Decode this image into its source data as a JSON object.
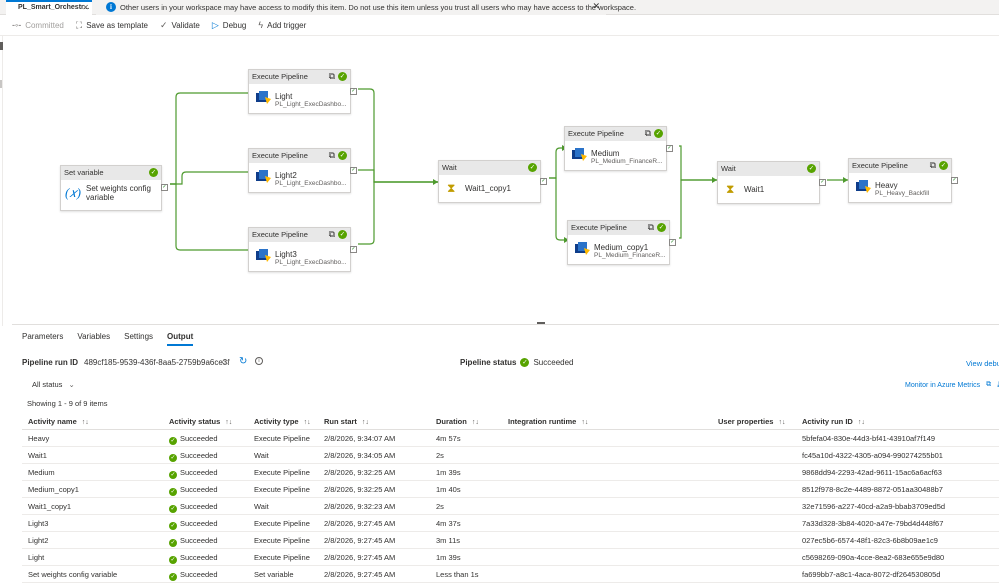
{
  "tab": {
    "title": "PL_Smart_Orchestr...",
    "close": "✕"
  },
  "banner": {
    "icon": "i",
    "text": "Other users in your workspace may have access to modify this item. Do not use this item unless you trust all users who may have access to the workspace.",
    "close": "✕"
  },
  "toolbar": {
    "committed": "Committed",
    "save_as_template": "Save as template",
    "validate": "Validate",
    "debug": "Debug",
    "add_trigger": "Add trigger"
  },
  "colors": {
    "accent": "#0078d4",
    "success": "#57a300",
    "edge": "#4e9a2e"
  },
  "nodes": {
    "set_variable": {
      "header": "Set variable",
      "title": "Set weights config variable",
      "icon": "x"
    },
    "light": {
      "header": "Execute Pipeline",
      "title": "Light",
      "sub": "PL_Light_ExecDashbo..."
    },
    "light2": {
      "header": "Execute Pipeline",
      "title": "Light2",
      "sub": "PL_Light_ExecDashbo..."
    },
    "light3": {
      "header": "Execute Pipeline",
      "title": "Light3",
      "sub": "PL_Light_ExecDashbo..."
    },
    "wait1_copy1": {
      "header": "Wait",
      "title": "Wait1_copy1"
    },
    "medium": {
      "header": "Execute Pipeline",
      "title": "Medium",
      "sub": "PL_Medium_FinanceR..."
    },
    "medium_copy1": {
      "header": "Execute Pipeline",
      "title": "Medium_copy1",
      "sub": "PL_Medium_FinanceR..."
    },
    "wait1": {
      "header": "Wait",
      "title": "Wait1"
    },
    "heavy": {
      "header": "Execute Pipeline",
      "title": "Heavy",
      "sub": "PL_Heavy_Backfill"
    }
  },
  "panel_tabs": [
    "Parameters",
    "Variables",
    "Settings",
    "Output"
  ],
  "run": {
    "label": "Pipeline run ID",
    "id": "489cf185-9539-436f-8aa5-2759b9a6ce3f",
    "status_label": "Pipeline status",
    "status": "Succeeded",
    "view_debug": "View debu"
  },
  "filter": {
    "label": "All status",
    "chevron": "⌄"
  },
  "monitor_link": "Monitor in Azure Metrics",
  "showing": "Showing 1 - 9 of 9 items",
  "table": {
    "columns": [
      "Activity name",
      "Activity status",
      "Activity type",
      "Run start",
      "Duration",
      "Integration runtime",
      "User properties",
      "Activity run ID"
    ],
    "rows": [
      [
        "Heavy",
        "Succeeded",
        "Execute Pipeline",
        "2/8/2026, 9:34:07 AM",
        "4m 57s",
        "",
        "",
        "5bfefa04-830e-44d3-bf41-43910af7f149"
      ],
      [
        "Wait1",
        "Succeeded",
        "Wait",
        "2/8/2026, 9:34:05 AM",
        "2s",
        "",
        "",
        "fc45a10d-4322-4305-a094-990274255b01"
      ],
      [
        "Medium",
        "Succeeded",
        "Execute Pipeline",
        "2/8/2026, 9:32:25 AM",
        "1m 39s",
        "",
        "",
        "9868dd94-2293-42ad-9611-15ac6a6acf63"
      ],
      [
        "Medium_copy1",
        "Succeeded",
        "Execute Pipeline",
        "2/8/2026, 9:32:25 AM",
        "1m 40s",
        "",
        "",
        "8512f978-8c2e-4489-8872-051aa30488b7"
      ],
      [
        "Wait1_copy1",
        "Succeeded",
        "Wait",
        "2/8/2026, 9:32:23 AM",
        "2s",
        "",
        "",
        "32e71596-a227-40cd-a2a9-bbab3709ed5d"
      ],
      [
        "Light3",
        "Succeeded",
        "Execute Pipeline",
        "2/8/2026, 9:27:45 AM",
        "4m 37s",
        "",
        "",
        "7a33d328-3b84-4020-a47e-79bd4d448f67"
      ],
      [
        "Light2",
        "Succeeded",
        "Execute Pipeline",
        "2/8/2026, 9:27:45 AM",
        "3m 11s",
        "",
        "",
        "027ec5b6-6574-48f1-82c3-6b8b09ae1c9"
      ],
      [
        "Light",
        "Succeeded",
        "Execute Pipeline",
        "2/8/2026, 9:27:45 AM",
        "1m 39s",
        "",
        "",
        "c5698269-090a-4cce-8ea2-683e655e9d80"
      ],
      [
        "Set weights config variable",
        "Succeeded",
        "Set variable",
        "2/8/2026, 9:27:45 AM",
        "Less than 1s",
        "",
        "",
        "fa699bb7-a8c1-4aca-8072-df264530805d"
      ]
    ]
  }
}
